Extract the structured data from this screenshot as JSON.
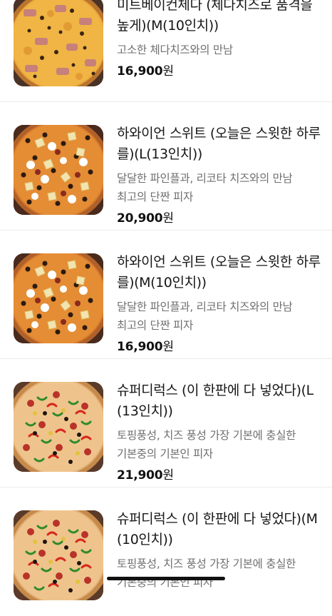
{
  "colors": {
    "name_text": "#161616",
    "desc_text": "#6f6f6f",
    "price_text": "#111111",
    "divider": "#ececec"
  },
  "menu": {
    "items": [
      {
        "name": "미트베이컨체다 (체다치즈로 품격을 높게)(M(10인치))",
        "description": "고소한 체다치즈와의 만남",
        "price": "16,900",
        "currency": "원",
        "image": "meat-bacon-cheddar-pizza-image"
      },
      {
        "name": "하와이언 스위트 (오늘은 스윗한 하루를)(L(13인치))",
        "description": "달달한 파인플과, 리코타 치즈와의 만남\n최고의 단짠 피자",
        "price": "20,900",
        "currency": "원",
        "image": "hawaiian-sweet-pizza-image"
      },
      {
        "name": "하와이언 스위트 (오늘은 스윗한 하루를)(M(10인치))",
        "description": "달달한 파인플과, 리코타 치즈와의 만남\n최고의 단짠 피자",
        "price": "16,900",
        "currency": "원",
        "image": "hawaiian-sweet-pizza-image"
      },
      {
        "name": "슈퍼디럭스 (이 한판에 다 넣었다)(L(13인치))",
        "description": "토핑풍성, 치즈 풍성 가장 기본에 충실한\n기본중의 기본인 피자",
        "price": "21,900",
        "currency": "원",
        "image": "super-deluxe-pizza-image"
      },
      {
        "name": "슈퍼디럭스 (이 한판에 다 넣었다)(M(10인치))",
        "description": "토핑풍성, 치즈 풍성 가장 기본에 충실한\n기본중의 기본인 피자",
        "price": "",
        "currency": "",
        "image": "super-deluxe-pizza-image"
      }
    ]
  }
}
